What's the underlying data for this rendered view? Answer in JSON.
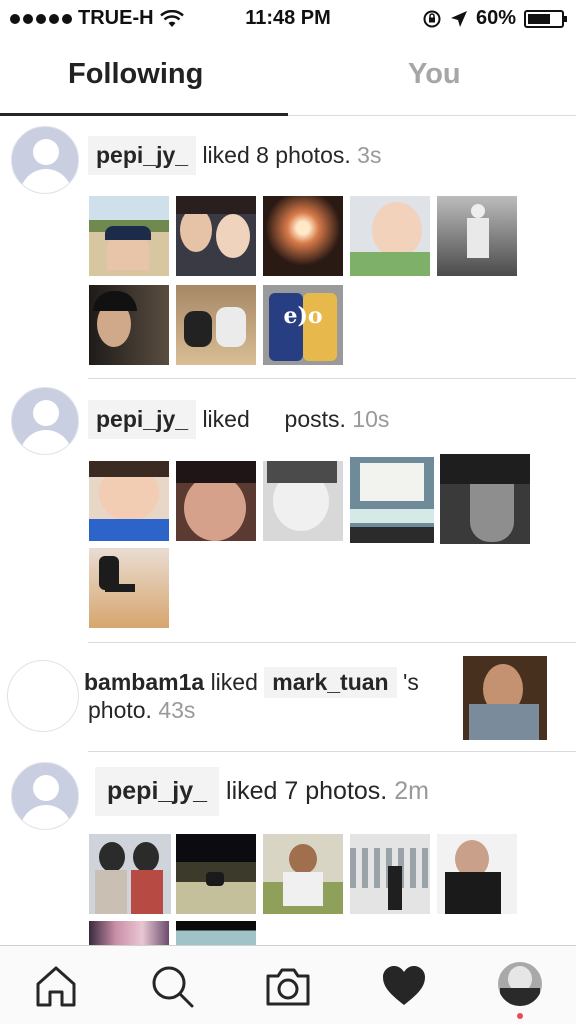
{
  "status_bar": {
    "carrier": "TRUE-H",
    "time": "11:48 PM",
    "battery_percent": "60%",
    "battery_level": 0.6
  },
  "tabs": [
    {
      "label": "Following",
      "active": true
    },
    {
      "label": "You",
      "active": false
    }
  ],
  "feed": [
    {
      "username": "pepi_jy_",
      "action": "liked 8 photos.",
      "time": "3s",
      "thumbnail_count": 8
    },
    {
      "username": "pepi_jy_",
      "action_part1": "liked",
      "action_part2": "posts.",
      "time": "10s",
      "thumbnail_count": 6
    },
    {
      "username": "bambam1a",
      "action": "liked",
      "target_user": "mark_tuan",
      "suffix": "'s",
      "line2": "photo.",
      "time": "43s"
    },
    {
      "username": "pepi_jy_",
      "action": "liked 7 photos.",
      "time": "2m",
      "thumbnail_count": 7
    }
  ],
  "bottom_nav": [
    {
      "icon": "home-icon"
    },
    {
      "icon": "search-icon"
    },
    {
      "icon": "camera-icon"
    },
    {
      "icon": "heart-icon",
      "active": true
    },
    {
      "icon": "profile-avatar"
    }
  ],
  "colors": {
    "text": "#262626",
    "muted": "#999999",
    "notification_dot": "#ed4956"
  }
}
